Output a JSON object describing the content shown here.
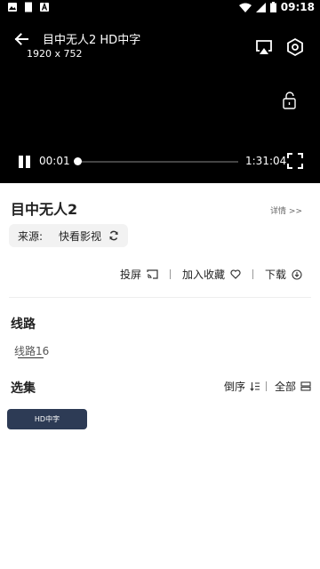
{
  "status_bar": {
    "time": "09:18"
  },
  "player": {
    "title": "目中无人2 HD中字",
    "resolution": "1920 x 752",
    "current_time": "00:01",
    "total_time": "1:31:04",
    "progress": 0.0
  },
  "video": {
    "title": "目中无人2",
    "details_link": "详情 >>"
  },
  "source": {
    "label": "来源:",
    "value": "快看影视"
  },
  "actions": {
    "cast": "投屏",
    "favorite": "加入收藏",
    "download": "下载"
  },
  "lines": {
    "heading": "线路",
    "items": [
      "线路16"
    ]
  },
  "episodes": {
    "heading": "选集",
    "sort": "倒序",
    "all": "全部",
    "items": [
      "HD中字"
    ]
  },
  "colors": {
    "player_bg": "#000000",
    "episode_chip": "#2d3b55"
  }
}
